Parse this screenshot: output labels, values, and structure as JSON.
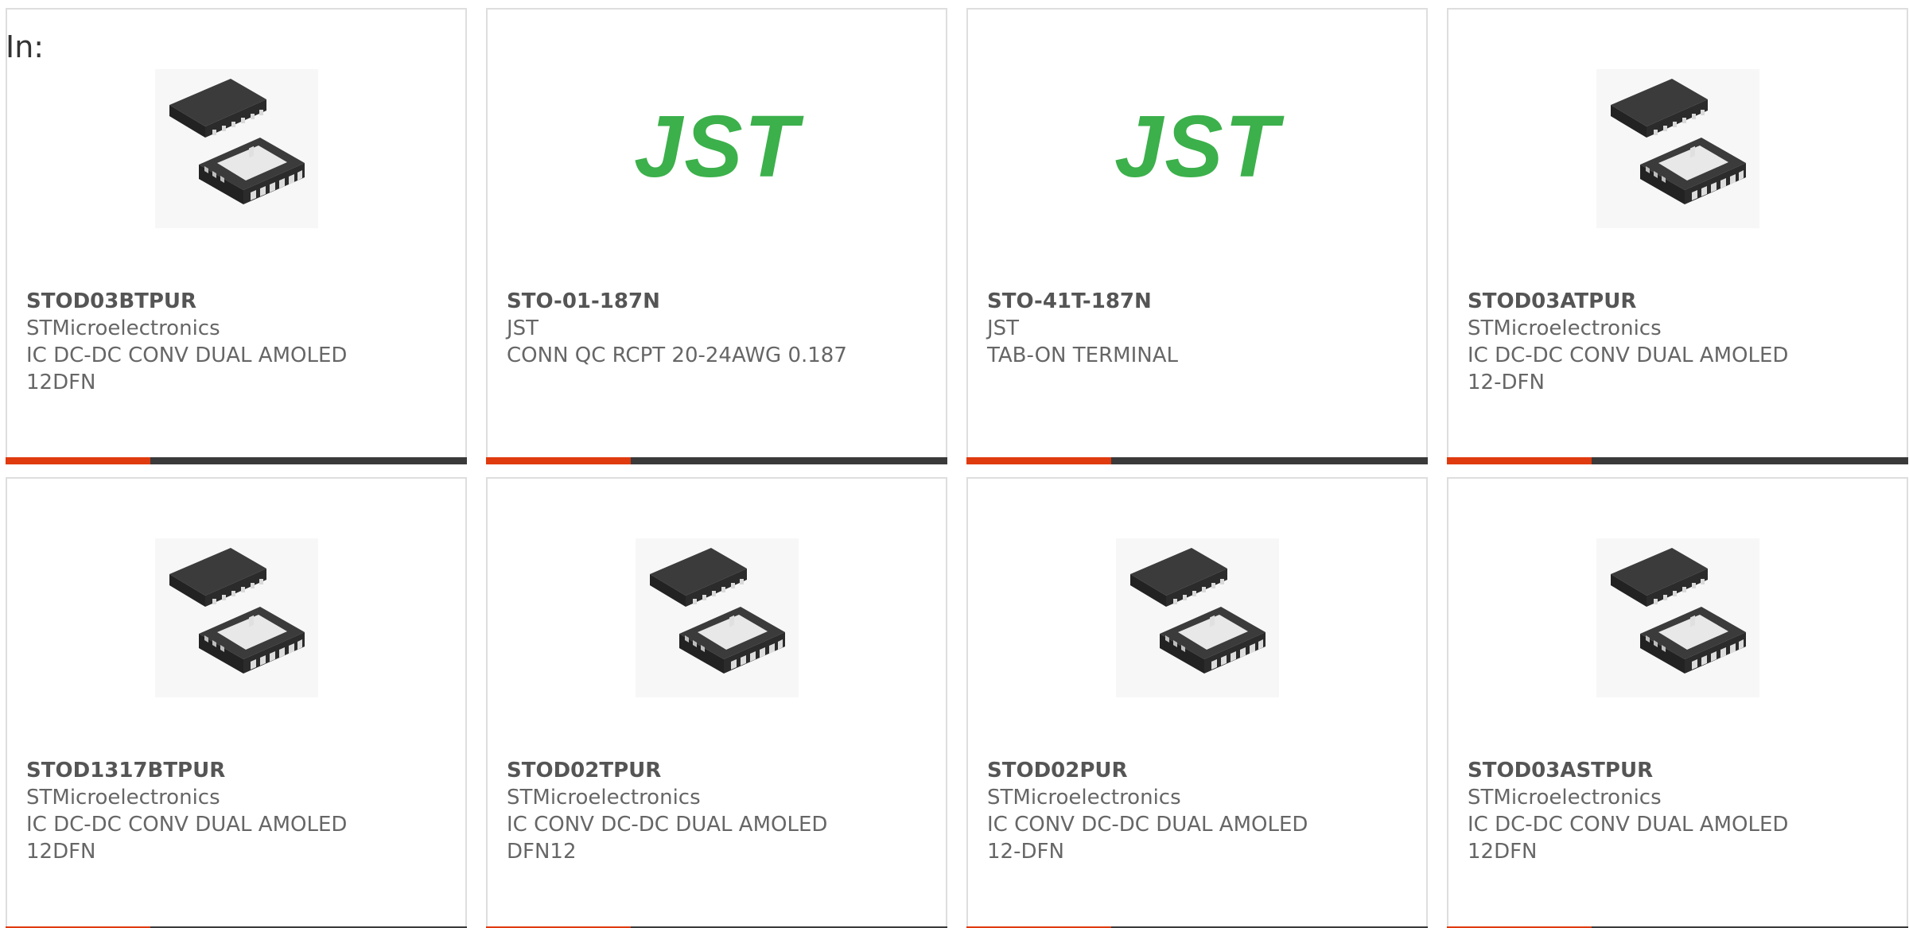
{
  "header": {
    "in_label": "In:"
  },
  "colors": {
    "accent": "#e03a0f",
    "bar": "#3a3a3a",
    "jst_green": "#3cb04b"
  },
  "cards": [
    {
      "part_number": "STOD03BTPUR",
      "manufacturer": "STMicroelectronics",
      "desc1": "IC DC-DC CONV DUAL AMOLED",
      "desc2": "12DFN",
      "image": "dfn12-chip-icon"
    },
    {
      "part_number": "STO-01-187N",
      "manufacturer": "JST",
      "desc1": "CONN QC RCPT 20-24AWG 0.187",
      "desc2": "",
      "image": "jst-logo",
      "logo_text": "JST"
    },
    {
      "part_number": "STO-41T-187N",
      "manufacturer": "JST",
      "desc1": "TAB-ON TERMINAL",
      "desc2": "",
      "image": "jst-logo",
      "logo_text": "JST"
    },
    {
      "part_number": "STOD03ATPUR",
      "manufacturer": "STMicroelectronics",
      "desc1": "IC DC-DC CONV DUAL AMOLED",
      "desc2": "12-DFN",
      "image": "dfn12-chip-icon"
    },
    {
      "part_number": "STOD1317BTPUR",
      "manufacturer": "STMicroelectronics",
      "desc1": "IC DC-DC CONV DUAL AMOLED",
      "desc2": "12DFN",
      "image": "dfn12-chip-icon"
    },
    {
      "part_number": "STOD02TPUR",
      "manufacturer": "STMicroelectronics",
      "desc1": "IC CONV DC-DC DUAL AMOLED",
      "desc2": "DFN12",
      "image": "dfn12-chip-icon"
    },
    {
      "part_number": "STOD02PUR",
      "manufacturer": "STMicroelectronics",
      "desc1": "IC CONV DC-DC DUAL AMOLED",
      "desc2": "12-DFN",
      "image": "dfn12-chip-icon"
    },
    {
      "part_number": "STOD03ASTPUR",
      "manufacturer": "STMicroelectronics",
      "desc1": "IC DC-DC CONV DUAL AMOLED",
      "desc2": "12DFN",
      "image": "dfn12-chip-icon"
    }
  ]
}
